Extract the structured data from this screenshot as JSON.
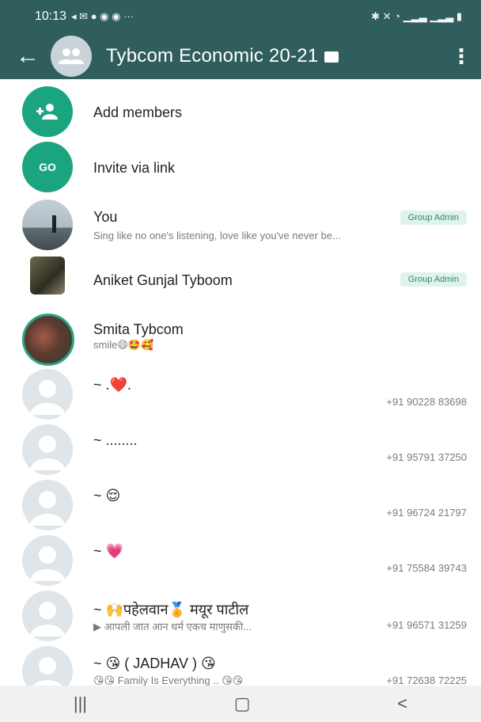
{
  "status": {
    "time": "10:13",
    "left_icons": "◂ ✉ ● ◉ ◉ ···",
    "right_icons": "✱ ✕ ◔ ▁▂▃ ▁▂▃ ▮"
  },
  "header": {
    "title": "Tybcom Economic 20-21",
    "back_icon": "←",
    "menu_icon": "⋮"
  },
  "actions": [
    {
      "label": "Add members",
      "icon": "+👥"
    },
    {
      "label": "Invite via link",
      "icon": "GO"
    }
  ],
  "members": [
    {
      "name": "You",
      "status": "Sing like no one's listening, love like you've never be...",
      "badge": "Group Admin",
      "phone": ""
    },
    {
      "name": "Aniket Gunjal Tyboom",
      "status": "",
      "badge": "Group Admin",
      "phone": ""
    },
    {
      "name": "Smita Tybcom",
      "status": "smile😄🤩🥰",
      "badge": "",
      "phone": ""
    },
    {
      "name": "~ .❤️.",
      "status": "",
      "badge": "",
      "phone": "+91 90228 83698"
    },
    {
      "name": "~ ........",
      "status": "",
      "badge": "",
      "phone": "+91 95791 37250"
    },
    {
      "name": "~ 😌",
      "status": "",
      "badge": "",
      "phone": "+91 96724 21797"
    },
    {
      "name": "~ 💗",
      "status": "",
      "badge": "",
      "phone": "+91 75584 39743"
    },
    {
      "name": "~ 🙌पहेलवान🏅 मयूर पाटील",
      "status": "▶ आपली जात आन धर्म एकच माणुसकी...",
      "badge": "",
      "phone": "+91 96571 31259"
    },
    {
      "name": "~ 😘 ( JADHAV ) 😘",
      "status": "😘😘 Family Is Everything .. 😘😘",
      "badge": "",
      "phone": "+91 72638 72225"
    }
  ],
  "nav": {
    "recent": "|||",
    "home": "▢",
    "back": "<"
  },
  "colors": {
    "header": "#2f5e5d",
    "accent": "#1aa57f"
  }
}
